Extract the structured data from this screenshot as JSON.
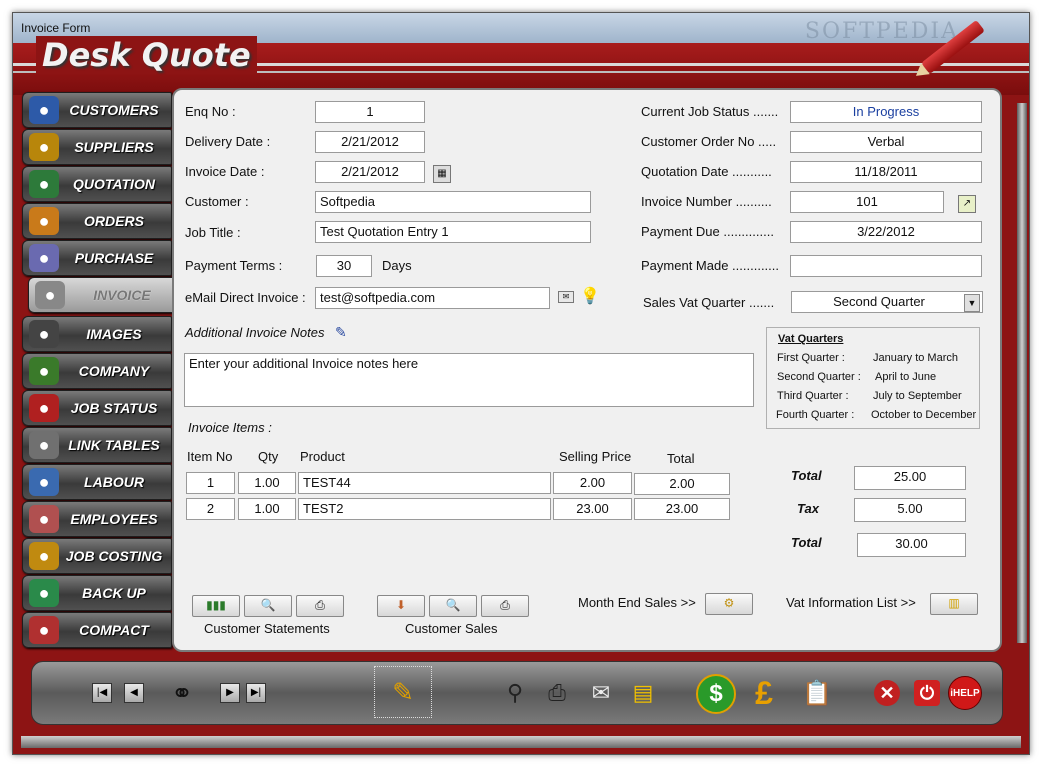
{
  "window": {
    "title": "Invoice Form",
    "watermark": "SOFTPEDIA"
  },
  "app": {
    "title": "Desk Quote"
  },
  "sidebar": {
    "items": [
      {
        "label": "CUSTOMERS",
        "icon": "customers-icon",
        "color": "#2d5aa8"
      },
      {
        "label": "SUPPLIERS",
        "icon": "suppliers-icon",
        "color": "#b8860b"
      },
      {
        "label": "QUOTATION",
        "icon": "quotation-icon",
        "color": "#2d7a3a"
      },
      {
        "label": "ORDERS",
        "icon": "orders-icon",
        "color": "#c97a1a"
      },
      {
        "label": "PURCHASE",
        "icon": "purchase-icon",
        "color": "#6a6ab0"
      },
      {
        "label": "INVOICE",
        "icon": "invoice-icon",
        "color": "#888888",
        "active": true
      },
      {
        "label": "IMAGES",
        "icon": "images-icon",
        "color": "#444444"
      },
      {
        "label": "COMPANY",
        "icon": "company-icon",
        "color": "#3a7a2a"
      },
      {
        "label": "JOB STATUS",
        "icon": "job-status-icon",
        "color": "#b02020"
      },
      {
        "label": "LINK TABLES",
        "icon": "link-tables-icon",
        "color": "#707070"
      },
      {
        "label": "LABOUR",
        "icon": "labour-icon",
        "color": "#3a6ab0"
      },
      {
        "label": "EMPLOYEES",
        "icon": "employees-icon",
        "color": "#b05050"
      },
      {
        "label": "JOB COSTING",
        "icon": "job-costing-icon",
        "color": "#c08a10"
      },
      {
        "label": "BACK UP",
        "icon": "back-up-icon",
        "color": "#2a8a4a"
      },
      {
        "label": "COMPACT",
        "icon": "compact-icon",
        "color": "#b03030"
      }
    ]
  },
  "form": {
    "enq_no": {
      "label": "Enq No :",
      "value": "1"
    },
    "delivery_date": {
      "label": "Delivery Date :",
      "value": "2/21/2012"
    },
    "invoice_date": {
      "label": "Invoice Date :",
      "value": "2/21/2012"
    },
    "customer": {
      "label": "Customer :",
      "value": "Softpedia"
    },
    "job_title": {
      "label": "Job Title :",
      "value": "Test Quotation Entry 1"
    },
    "payment_terms": {
      "label": "Payment Terms :",
      "value": "30",
      "unit": "Days"
    },
    "email": {
      "label": "eMail Direct Invoice :",
      "value": "test@softpedia.com"
    },
    "current_job_status": {
      "label": "Current Job Status .......",
      "value": "In Progress"
    },
    "customer_order_no": {
      "label": "Customer Order No .....",
      "value": "Verbal"
    },
    "quotation_date": {
      "label": "Quotation Date ...........",
      "value": "11/18/2011"
    },
    "invoice_number": {
      "label": "Invoice Number ..........",
      "value": "101"
    },
    "payment_due": {
      "label": "Payment Due ..............",
      "value": "3/22/2012"
    },
    "payment_made": {
      "label": "Payment Made .............",
      "value": ""
    },
    "sales_vat_quarter": {
      "label": "Sales Vat Quarter .......",
      "value": "Second Quarter"
    },
    "notes": {
      "label": "Additional Invoice Notes",
      "value": "Enter your additional Invoice notes here"
    }
  },
  "vat_quarters": {
    "title": "Vat Quarters",
    "rows": [
      {
        "name": "First Quarter :",
        "range": "January  to March"
      },
      {
        "name": "Second Quarter :",
        "range": "April to June"
      },
      {
        "name": "Third Quarter :",
        "range": "July to September"
      },
      {
        "name": "Fourth Quarter :",
        "range": "October to December"
      }
    ]
  },
  "items": {
    "title": "Invoice Items :",
    "headers": {
      "item_no": "Item No",
      "qty": "Qty",
      "product": "Product",
      "price": "Selling Price",
      "total": "Total"
    },
    "rows": [
      {
        "item_no": "1",
        "qty": "1.00",
        "product": "TEST44",
        "price": "2.00",
        "total": "2.00"
      },
      {
        "item_no": "2",
        "qty": "1.00",
        "product": "TEST2",
        "price": "23.00",
        "total": "23.00"
      }
    ]
  },
  "totals": {
    "total_label": "Total",
    "total": "25.00",
    "tax_label": "Tax",
    "tax": "5.00",
    "grand_label": "Total",
    "grand": "30.00"
  },
  "actions": {
    "customer_statements": "Customer Statements",
    "customer_sales": "Customer Sales",
    "month_end_sales": "Month End Sales >>",
    "vat_info": "Vat Information List >>"
  },
  "footer": {
    "help_label": "iHELP"
  }
}
